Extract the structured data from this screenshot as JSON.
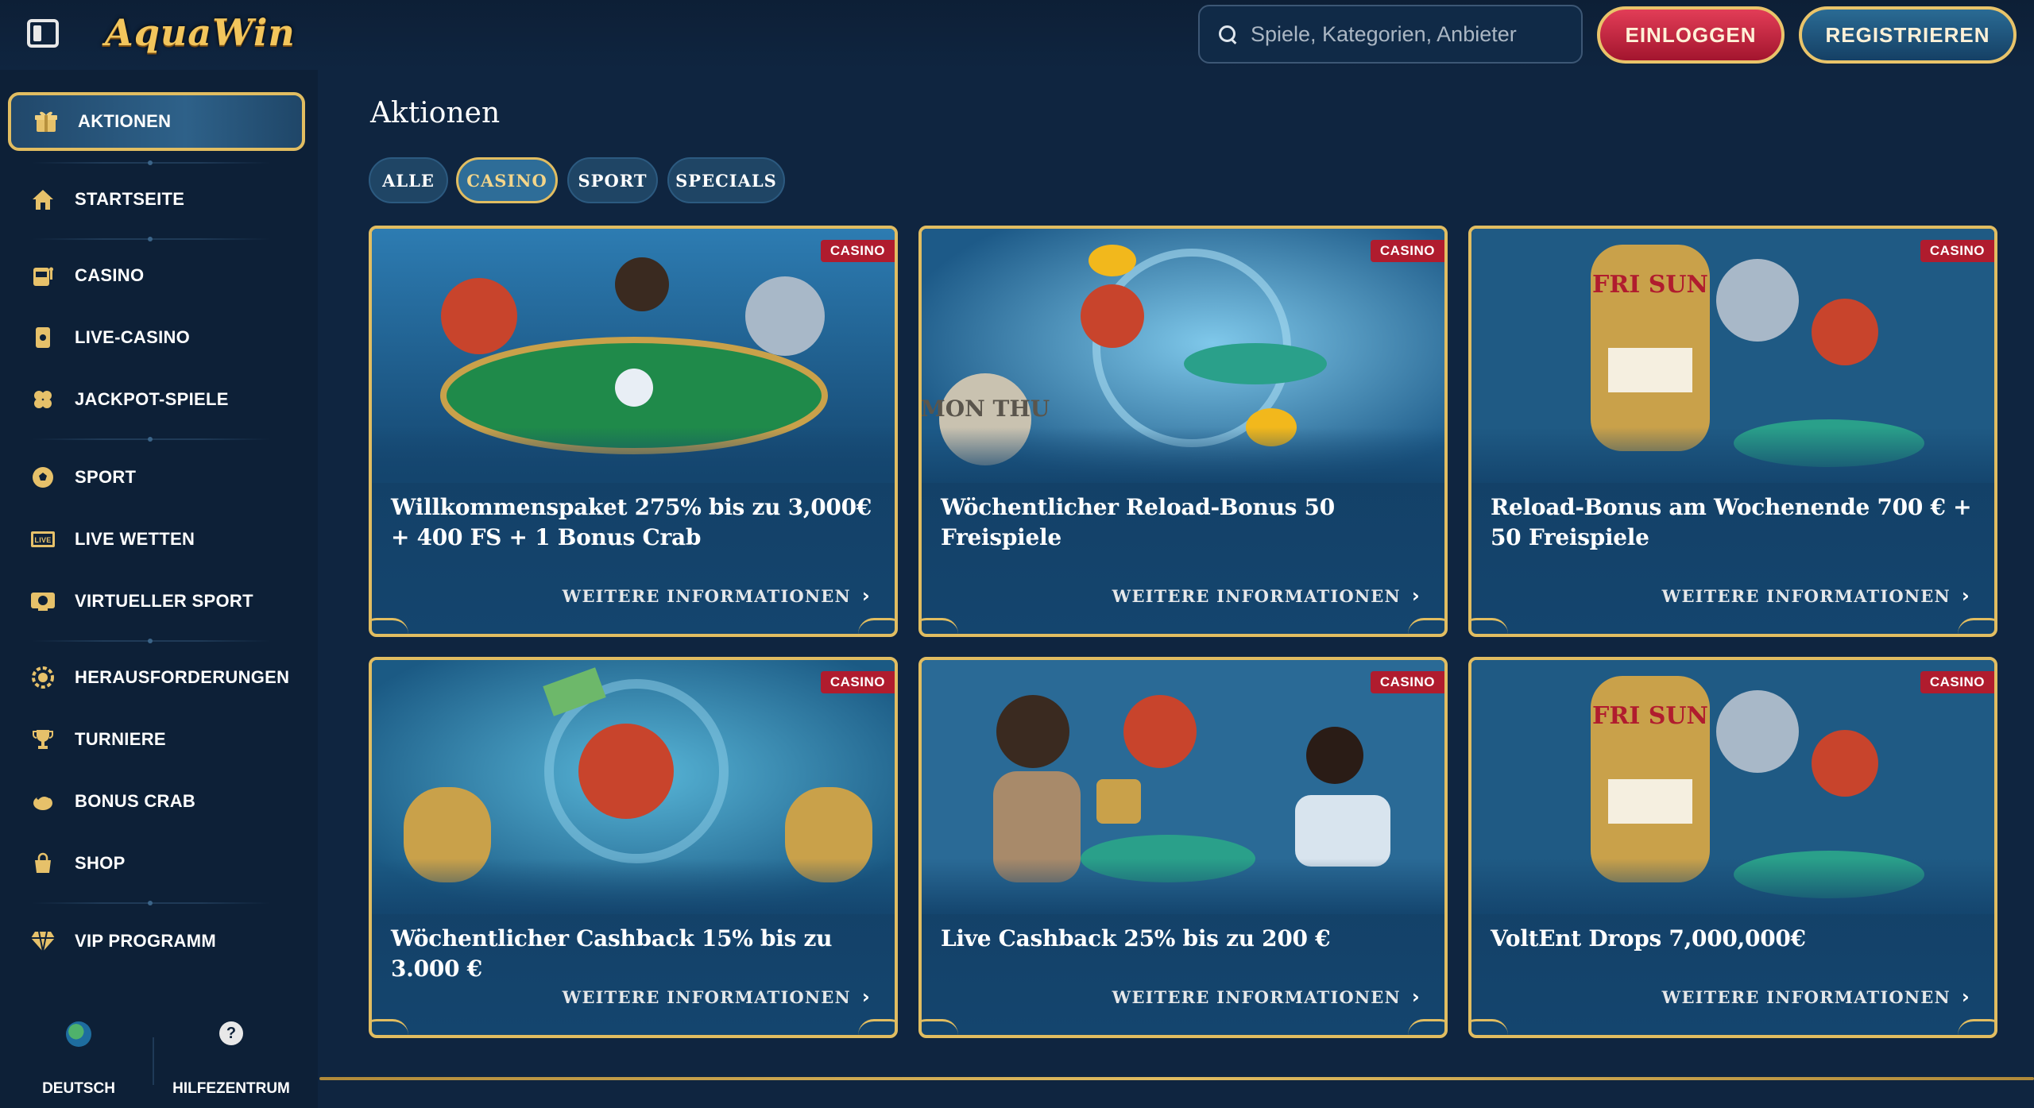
{
  "header": {
    "logo": "AquaWin",
    "search_placeholder": "Spiele, Kategorien, Anbieter",
    "login_label": "EINLOGGEN",
    "register_label": "REGISTRIEREN"
  },
  "sidebar": {
    "items": [
      {
        "label": "AKTIONEN",
        "icon": "gift-icon"
      },
      {
        "label": "STARTSEITE",
        "icon": "home-icon"
      },
      {
        "label": "CASINO",
        "icon": "slot-machine-icon"
      },
      {
        "label": "LIVE-CASINO",
        "icon": "live-casino-icon"
      },
      {
        "label": "JACKPOT-SPIELE",
        "icon": "clover-icon"
      },
      {
        "label": "SPORT",
        "icon": "soccer-ball-icon"
      },
      {
        "label": "LIVE WETTEN",
        "icon": "live-badge-icon"
      },
      {
        "label": "VIRTUELLER SPORT",
        "icon": "virtual-sport-icon"
      },
      {
        "label": "HERAUSFORDERUNGEN",
        "icon": "challenge-gear-icon"
      },
      {
        "label": "TURNIERE",
        "icon": "trophy-icon"
      },
      {
        "label": "BONUS CRAB",
        "icon": "crab-icon"
      },
      {
        "label": "SHOP",
        "icon": "shopping-bag-icon"
      },
      {
        "label": "VIP PROGRAMM",
        "icon": "diamond-icon"
      }
    ],
    "language_label": "DEUTSCH",
    "help_label": "HILFEZENTRUM"
  },
  "main": {
    "title": "Aktionen",
    "tabs": [
      {
        "label": "ALLE",
        "active": false
      },
      {
        "label": "CASINO",
        "active": true
      },
      {
        "label": "SPORT",
        "active": false
      },
      {
        "label": "SPECIALS",
        "active": false
      }
    ],
    "more_label": "WEITERE INFORMATIONEN",
    "cards": [
      {
        "badge": "CASINO",
        "title": "Willkommenspaket 275% bis zu 3,000€ + 400 FS + 1 Bonus Crab"
      },
      {
        "badge": "CASINO",
        "title": "Wöchentlicher Reload-Bonus 50 Freispiele",
        "image_text": "MON THU"
      },
      {
        "badge": "CASINO",
        "title": "Reload-Bonus am Wochenende 700 € + 50 Freispiele",
        "image_text": "FRI SUN"
      },
      {
        "badge": "CASINO",
        "title": "Wöchentlicher Cashback 15% bis zu 3.000 €"
      },
      {
        "badge": "CASINO",
        "title": "Live Cashback 25% bis zu 200 €"
      },
      {
        "badge": "CASINO",
        "title": "VoltEnt Drops 7,000,000€",
        "image_text": "FRI SUN"
      }
    ]
  },
  "colors": {
    "background": "#0f2540",
    "sidebar": "#0d2037",
    "gold_border": "#e1bd61",
    "login_red": "#c8233e",
    "badge_red": "#b01c2e",
    "card_blue": "#14456e"
  }
}
